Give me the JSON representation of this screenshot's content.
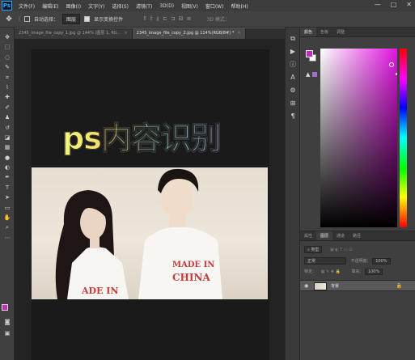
{
  "app": {
    "logo": "Ps"
  },
  "menu": [
    "文件(F)",
    "编辑(E)",
    "图像(I)",
    "文字(Y)",
    "选择(S)",
    "滤镜(T)",
    "3D(D)",
    "视图(V)",
    "窗口(W)",
    "帮助(H)"
  ],
  "window_controls": [
    "—",
    "□",
    "✕"
  ],
  "options": {
    "auto_select_label": "自动选择：",
    "auto_select_value": "图层",
    "show_transform_label": "显示变换控件",
    "mode_3d_label": "3D 模式："
  },
  "tabs": [
    {
      "label": "2345_image_file_copy_1.jpg @ 144% (图层 1, RG...",
      "close": "×",
      "active": false
    },
    {
      "label": "2345_image_file_copy_2.jpg @ 114%(RGB/8#) *",
      "close": "×",
      "active": true
    }
  ],
  "tools": [
    "move-icon",
    "marquee-icon",
    "lasso-icon",
    "quick-select-icon",
    "crop-icon",
    "eyedropper-icon",
    "healing-icon",
    "brush-icon",
    "stamp-icon",
    "history-brush-icon",
    "eraser-icon",
    "gradient-icon",
    "blur-icon",
    "dodge-icon",
    "pen-icon",
    "type-icon",
    "path-select-icon",
    "shape-icon",
    "hand-icon",
    "zoom-icon"
  ],
  "overlay_title": "ps内容识别",
  "color_panel": {
    "tabs": [
      "颜色",
      "色板",
      "调整"
    ],
    "foreground": "#c42bc4",
    "background": "#ffffff"
  },
  "layers_panel": {
    "tabs": [
      "属性",
      "图层",
      "通道",
      "路径"
    ],
    "filter_label": "类型",
    "blend_mode": "正常",
    "opacity_label": "不透明度：",
    "opacity_value": "100%",
    "lock_label": "锁定：",
    "fill_label": "填充：",
    "fill_value": "100%",
    "layer_name": "背景"
  },
  "colors": {
    "accent": "#31a8ff",
    "panel_bg": "#3f3f3f",
    "canvas_bg": "#232323"
  }
}
